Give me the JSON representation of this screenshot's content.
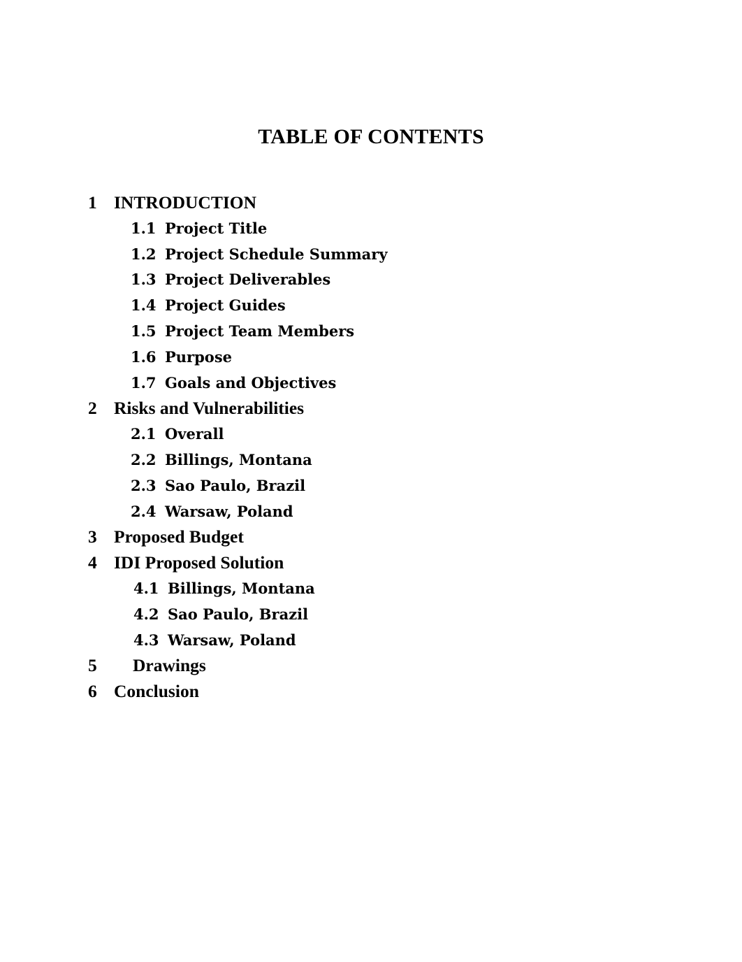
{
  "document": {
    "title": "TABLE OF CONTENTS",
    "background_color": "#ffffff",
    "text_color": "#000000"
  },
  "toc": {
    "entries": [
      {
        "number": "1",
        "label": "INTRODUCTION",
        "level": 1
      },
      {
        "number": "1.1",
        "label": "Project Title",
        "level": 2
      },
      {
        "number": "1.2",
        "label": "Project Schedule Summary",
        "level": 2
      },
      {
        "number": "1.3",
        "label": "Project Deliverables",
        "level": 2
      },
      {
        "number": "1.4",
        "label": "Project Guides",
        "level": 2
      },
      {
        "number": "1.5",
        "label": "Project Team Members",
        "level": 2
      },
      {
        "number": "1.6",
        "label": "Purpose",
        "level": 2
      },
      {
        "number": "1.7",
        "label": "Goals and Objectives",
        "level": 2
      },
      {
        "number": "2",
        "label": "Risks and Vulnerabilities",
        "level": 1
      },
      {
        "number": "2.1",
        "label": "Overall",
        "level": 2
      },
      {
        "number": "2.2",
        "label": "Billings, Montana",
        "level": 2
      },
      {
        "number": "2.3",
        "label": "Sao Paulo, Brazil",
        "level": 2
      },
      {
        "number": "2.4",
        "label": "Warsaw, Poland",
        "level": 2
      },
      {
        "number": "3",
        "label": "Proposed Budget",
        "level": 1
      },
      {
        "number": "4",
        "label": "IDI Proposed Solution",
        "level": 1
      },
      {
        "number": "4.1",
        "label": "Billings, Montana",
        "level": 2
      },
      {
        "number": "4.2",
        "label": "Sao Paulo, Brazil",
        "level": 2
      },
      {
        "number": "4.3",
        "label": "Warsaw, Poland",
        "level": 2
      },
      {
        "number": "5",
        "label": "Drawings",
        "level": 1
      },
      {
        "number": "6",
        "label": "Conclusion",
        "level": 1
      }
    ]
  }
}
